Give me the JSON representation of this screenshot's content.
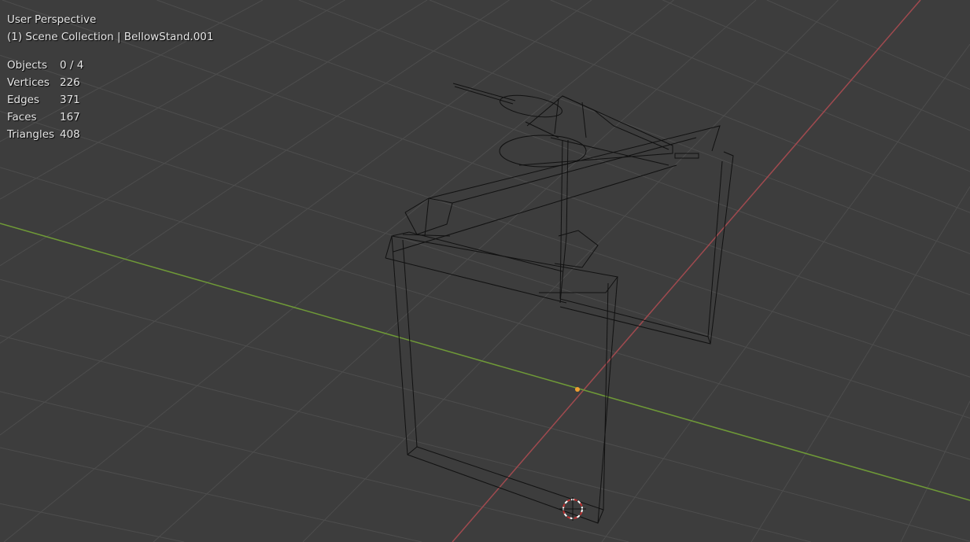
{
  "viewport": {
    "view_name": "User Perspective",
    "collection_line": "(1) Scene Collection | BellowStand.001",
    "stats": [
      {
        "label": "Objects",
        "value": "0 / 4"
      },
      {
        "label": "Vertices",
        "value": "226"
      },
      {
        "label": "Edges",
        "value": "371"
      },
      {
        "label": "Faces",
        "value": "167"
      },
      {
        "label": "Triangles",
        "value": "408"
      }
    ]
  },
  "colors": {
    "background": "#3d3d3d",
    "grid": "#505050",
    "x_axis": "#a04a4f",
    "y_axis": "#6f9a37",
    "origin": "#f0a030",
    "wire": "#111111"
  }
}
